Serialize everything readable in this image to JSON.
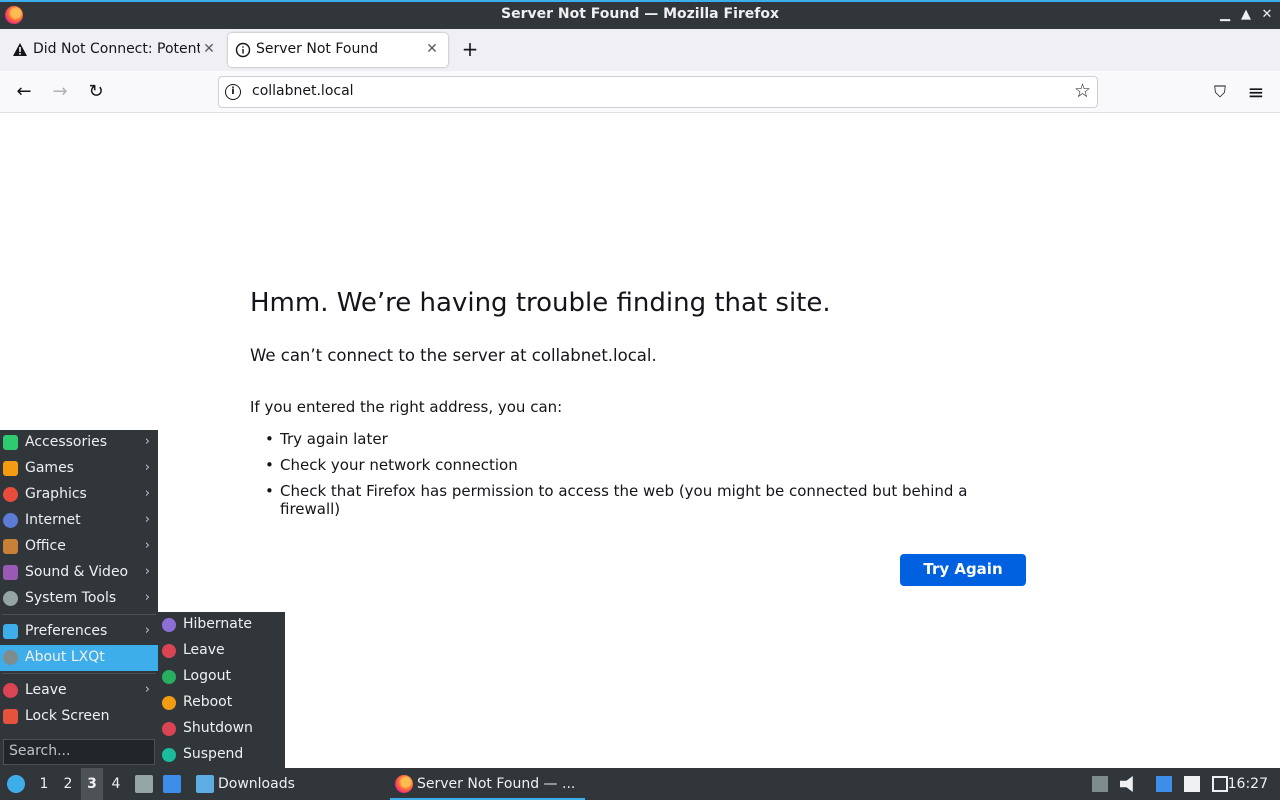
{
  "window": {
    "title": "Server Not Found — Mozilla Firefox",
    "minimize_glyph": "▁",
    "maximize_glyph": "▲",
    "close_glyph": "✕"
  },
  "tabs": [
    {
      "label": "Did Not Connect: Potenti",
      "icon": "warning-icon",
      "close": "✕"
    },
    {
      "label": "Server Not Found",
      "icon": "info-icon",
      "close": "✕"
    }
  ],
  "newtab": {
    "glyph": "+"
  },
  "nav": {
    "back": "←",
    "forward": "→",
    "reload": "↻",
    "url": "collabnet.local",
    "info_glyph": "i",
    "bookmark_glyph": "☆",
    "pocket_glyph": "⛉",
    "menu_glyph": "≡"
  },
  "error": {
    "title": "Hmm. We’re having trouble finding that site.",
    "desc": "We can’t connect to the server at collabnet.local.",
    "hint": "If you entered the right address, you can:",
    "items": [
      "Try again later",
      "Check your network connection",
      "Check that Firefox has permission to access the web (you might be connected but behind a firewall)"
    ],
    "button": "Try Again"
  },
  "lxqt_menu": {
    "items": [
      {
        "label": "Accessories",
        "icon": "accessories-icon",
        "color": "#2ecc71"
      },
      {
        "label": "Games",
        "icon": "games-icon",
        "color": "#f39c12"
      },
      {
        "label": "Graphics",
        "icon": "graphics-icon",
        "color": "#e74c3c"
      },
      {
        "label": "Internet",
        "icon": "internet-icon",
        "color": "#5b7bd5"
      },
      {
        "label": "Office",
        "icon": "office-icon",
        "color": "#c87f38"
      },
      {
        "label": "Sound & Video",
        "icon": "sound-video-icon",
        "color": "#9b59b6"
      },
      {
        "label": "System Tools",
        "icon": "system-tools-icon",
        "color": "#95a5a6"
      },
      {
        "label": "Preferences",
        "icon": "preferences-icon",
        "color": "#3daee9"
      },
      {
        "label": "About LXQt",
        "icon": "about-icon",
        "color": "#7f8c8d"
      },
      {
        "label": "Leave",
        "icon": "leave-icon",
        "color": "#da4453"
      },
      {
        "label": "Lock Screen",
        "icon": "lock-icon",
        "color": "#e5533d"
      }
    ],
    "arrow": "›",
    "search_placeholder": "Search..."
  },
  "leave_submenu": {
    "items": [
      {
        "label": "Hibernate",
        "color": "#8e6fd8"
      },
      {
        "label": "Leave",
        "color": "#da4453"
      },
      {
        "label": "Logout",
        "color": "#27ae60"
      },
      {
        "label": "Reboot",
        "color": "#f39c12"
      },
      {
        "label": "Shutdown",
        "color": "#da4453"
      },
      {
        "label": "Suspend",
        "color": "#1abc9c"
      }
    ]
  },
  "taskbar": {
    "desktops": [
      "1",
      "2",
      "3",
      "4"
    ],
    "active_desktop": "3",
    "downloads_label": "Downloads",
    "firefox_task": "Server Not Found — ...",
    "clock": "16:27"
  },
  "colors": {
    "accent": "#3daee9",
    "button_blue": "#0061e0",
    "panel_bg": "#31363b"
  }
}
